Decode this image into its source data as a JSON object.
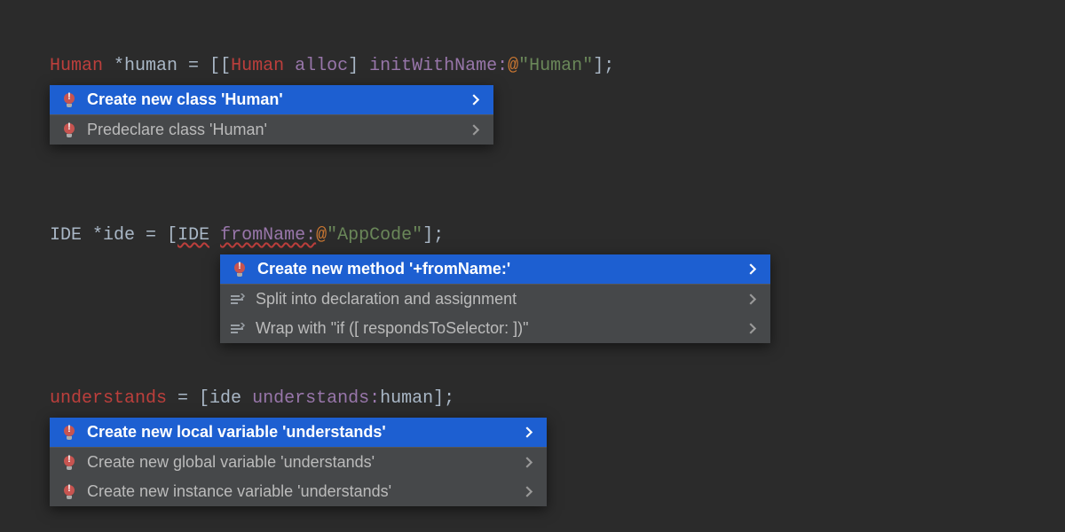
{
  "code": {
    "line1": {
      "type1": "Human",
      "star": " *",
      "var": "human",
      "eq": " = [[",
      "type2": "Human",
      "alloc": " alloc",
      "bracket1": "]",
      "sel": " initWithName:",
      "at": "@",
      "q1": "\"",
      "str": "Human",
      "q2": "\"",
      "end": "];"
    },
    "line2": {
      "type1": "IDE",
      "star": " *",
      "var": "ide",
      "eq": " = [",
      "type2": "IDE",
      "space": " ",
      "sel": "fromName:",
      "at": "@",
      "q1": "\"",
      "str": "AppCode",
      "q2": "\"",
      "end": "];"
    },
    "line3": {
      "err": "understands",
      "eq": " = [",
      "var1": "ide",
      "space": " ",
      "sel": "understands:",
      "var2": "human",
      "end": "];"
    }
  },
  "popups": {
    "p1": {
      "items": [
        {
          "label": "Create new class 'Human'",
          "selected": true,
          "icon": "bulb-error"
        },
        {
          "label": "Predeclare class 'Human'",
          "selected": false,
          "icon": "bulb-error"
        }
      ]
    },
    "p2": {
      "items": [
        {
          "label": "Create new method '+fromName:'",
          "selected": true,
          "icon": "bulb-error"
        },
        {
          "label": "Split into declaration and assignment",
          "selected": false,
          "icon": "intention"
        },
        {
          "label": "Wrap with \"if ([ respondsToSelector: ])\"",
          "selected": false,
          "icon": "intention"
        }
      ]
    },
    "p3": {
      "items": [
        {
          "label": "Create new local variable 'understands'",
          "selected": true,
          "icon": "bulb-error"
        },
        {
          "label": "Create new global variable 'understands'",
          "selected": false,
          "icon": "bulb-error"
        },
        {
          "label": "Create new instance variable 'understands'",
          "selected": false,
          "icon": "bulb-error"
        }
      ]
    }
  }
}
